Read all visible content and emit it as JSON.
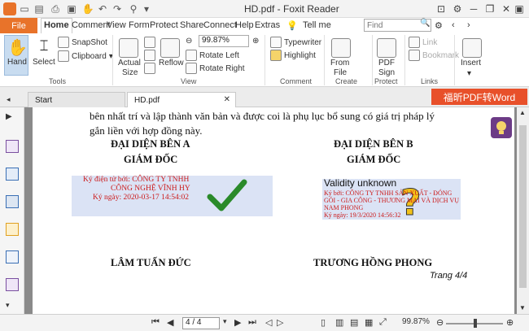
{
  "titlebar": {
    "title": "HD.pdf - Foxit Reader"
  },
  "menu": {
    "file": "File",
    "tabs": [
      "Home",
      "Comment",
      "View",
      "Form",
      "Protect",
      "Share",
      "Connect",
      "Help",
      "Extras"
    ],
    "tell_me": "Tell me",
    "find_placeholder": "Find"
  },
  "ribbon": {
    "hand": "Hand",
    "select": "Select",
    "snapshot": "SnapShot",
    "clipboard": "Clipboard",
    "actual_size_1": "Actual",
    "actual_size_2": "Size",
    "reflow": "Reflow",
    "zoom": "99.87%",
    "rotate_left": "Rotate Left",
    "rotate_right": "Rotate Right",
    "typewriter": "Typewriter",
    "highlight": "Highlight",
    "from_file_1": "From",
    "from_file_2": "File",
    "pdf_sign_1": "PDF",
    "pdf_sign_2": "Sign",
    "link": "Link",
    "bookmark": "Bookmark",
    "insert": "Insert",
    "groups": [
      "Tools",
      "View",
      "Comment",
      "Create",
      "Protect",
      "Links"
    ]
  },
  "tabs": {
    "start": "Start",
    "doc": "HD.pdf",
    "banner": "福昕PDF转Word"
  },
  "document": {
    "para_line1": "bên nhất trí và lập thành văn bản và được coi là phụ lục bổ sung có giá trị pháp lý",
    "para_line2": "gắn liền với hợp đồng này.",
    "party_a": "ĐẠI DIỆN BÊN A",
    "party_b": "ĐẠI DIỆN BÊN B",
    "director_a": "GIÁM ĐỐC",
    "director_b": "GIÁM ĐỐC",
    "sig_a_line1": "Ký điện tử bởi: CÔNG TY TNHH",
    "sig_a_line2": "CÔNG NGHỆ VĨNH HY",
    "sig_a_line3": "Ký ngày: 2020-03-17 14:54:02",
    "validity": "Validity unknown",
    "sig_b_line1": "Ký bởi: CÔNG TY TNHH SẢN XUẤT - ĐÓNG",
    "sig_b_line2": "GÓI - GIA CÔNG - THƯƠNG MẠI VÀ DỊCH VỤ",
    "sig_b_line3": "NAM PHONG",
    "sig_b_line4": "Ký ngày: 19/3/2020 14:56:32",
    "name_a": "LÂM TUẤN ĐỨC",
    "name_b": "TRƯƠNG HỒNG PHONG",
    "page_label": "Trang 4/4"
  },
  "status": {
    "page": "4 / 4",
    "zoom": "99.87%"
  },
  "colors": {
    "accent": "#e8732a",
    "banner": "#e8502a",
    "signature_text": "#cc1a1a",
    "check_green": "#2a8a2a"
  }
}
